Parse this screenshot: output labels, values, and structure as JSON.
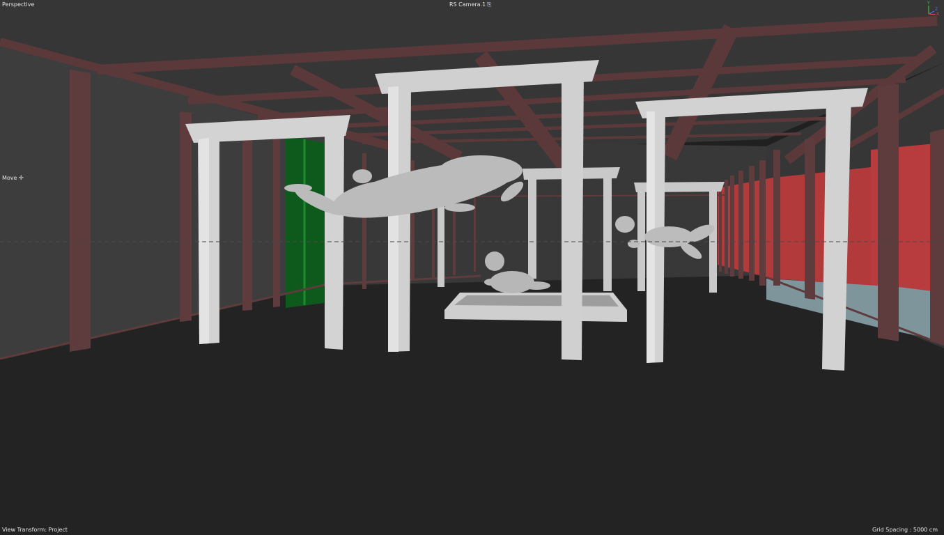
{
  "viewport": {
    "name": "Perspective",
    "camera": "RS Camera.1",
    "camera_icon": "camera-link-icon",
    "tool": {
      "label": "Move",
      "icon": "move-cross-icon"
    },
    "status": {
      "view_transform": "View Transform: Project",
      "grid_spacing": "Grid Spacing : 5000 cm"
    },
    "axes": {
      "y": "Y",
      "z": "Z",
      "x": "X"
    }
  },
  "colors": {
    "background": "#202020",
    "ceiling": "#353535",
    "floor": "#222222",
    "beam": "#5c3a3b",
    "arch": "#d4d4d4",
    "figure": "#b9b9b9",
    "door": "#0f5d1d",
    "red_wall": "#b53c3d",
    "glass": "#8aa4ac",
    "axis_x": "#e04444",
    "axis_y": "#44c144",
    "axis_z": "#4d6ff0"
  }
}
